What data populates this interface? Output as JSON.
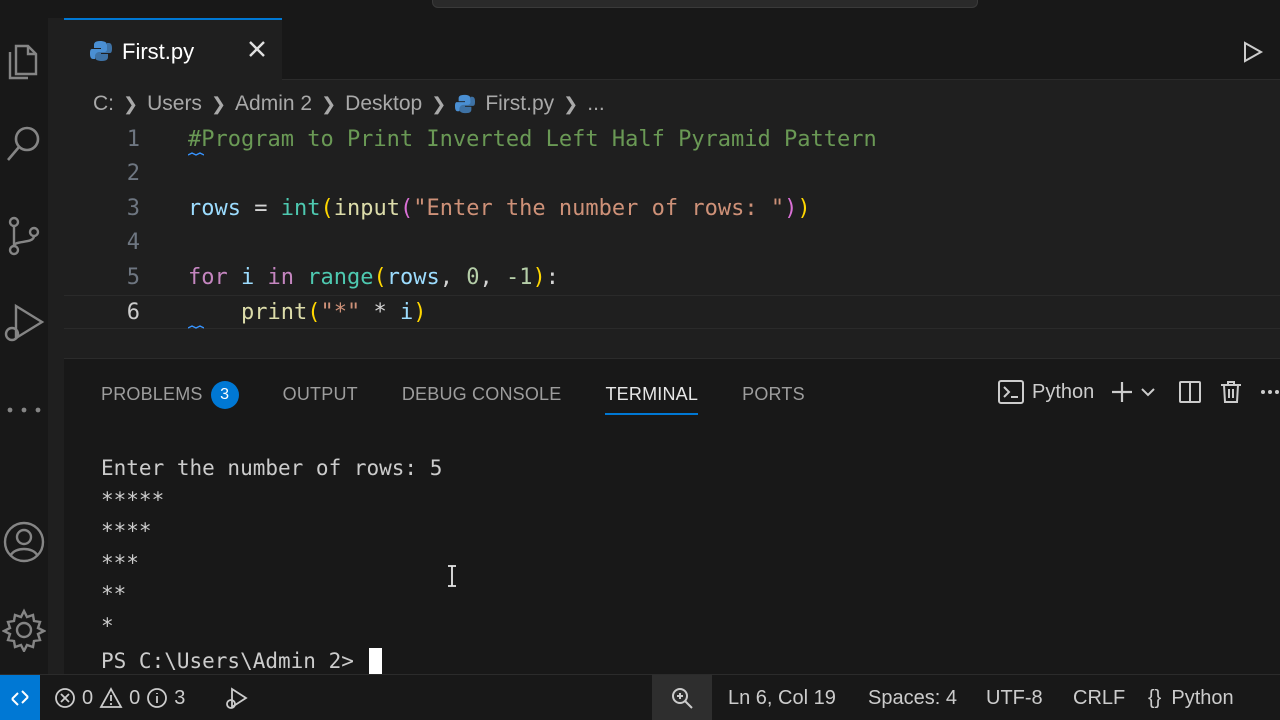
{
  "tab": {
    "filename": "First.py"
  },
  "breadcrumb": [
    "C:",
    "Users",
    "Admin 2",
    "Desktop",
    "First.py",
    "..."
  ],
  "editor": {
    "line_numbers": [
      "1",
      "2",
      "3",
      "4",
      "5",
      "6"
    ],
    "current_line": "6",
    "code": {
      "l1_comment": "#Program to Print Inverted Left Half Pyramid Pattern",
      "l3": {
        "var": "rows",
        "eq": " = ",
        "int": "int",
        "p1": "(",
        "input": "input",
        "p2": "(",
        "str": "\"Enter the number of rows: \"",
        "p3": ")",
        "p4": ")"
      },
      "l5": {
        "for": "for",
        "i": " i ",
        "in": "in",
        "sp": " ",
        "range": "range",
        "p1": "(",
        "rows": "rows",
        "c1": ", ",
        "zero": "0",
        "c2": ", ",
        "neg": "-1",
        "p2": ")",
        "colon": ":"
      },
      "l6": {
        "indent": "    ",
        "print": "print",
        "p1": "(",
        "str": "\"*\"",
        "op": " * ",
        "i": "i",
        "p2": ")"
      }
    }
  },
  "panel": {
    "tabs": {
      "problems": "PROBLEMS",
      "output": "OUTPUT",
      "debug": "DEBUG CONSOLE",
      "terminal": "TERMINAL",
      "ports": "PORTS"
    },
    "problems_count": "3",
    "terminal_profile": "Python",
    "terminal_lines": [
      "Enter the number of rows: 5",
      "*****",
      "****",
      "***",
      "**",
      "*"
    ],
    "prompt": "PS C:\\Users\\Admin 2> "
  },
  "status": {
    "errors": "0",
    "warnings": "0",
    "infos": "3",
    "position": "Ln 6, Col 19",
    "spaces": "Spaces: 4",
    "encoding": "UTF-8",
    "eol": "CRLF",
    "language": "Python"
  },
  "colors": {
    "accent": "#0078d4",
    "background": "#1f1f1f",
    "sidebar": "#181818"
  }
}
